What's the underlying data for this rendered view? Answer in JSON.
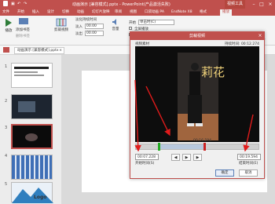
{
  "window": {
    "title": "动画演示 [兼容模式].pptx - PowerPoint(产品激活失败)",
    "tools_tab": "视频工具"
  },
  "tabs": [
    "文件",
    "开始",
    "插入",
    "设计",
    "切换",
    "动画",
    "幻灯片放映",
    "审阅",
    "视图",
    "口袋动画 PA",
    "EndNote X8",
    "格式",
    "播放"
  ],
  "ribbon": {
    "preview_label": "播放",
    "add_bookmark_label": "添加书签",
    "remove_bookmark_label": "删除书签",
    "trim_label": "剪裁视频",
    "fade_label": "淡化持续时间",
    "fade_in_label": "淡入",
    "fade_in_value": "00.00",
    "fade_out_label": "淡出",
    "fade_out_value": "00.00",
    "volume_label": "音量",
    "start_label": "开始",
    "start_value": "单击时(C)",
    "fullscreen_label": "全屏播放",
    "loop_label": "循环播放，直到停止"
  },
  "doc_tab": "动画演示 [兼容模式].pptx",
  "thumbnails": [
    {
      "number": "1"
    },
    {
      "number": "2"
    },
    {
      "number": "3"
    },
    {
      "number": "4"
    },
    {
      "number": "5",
      "logo_text": "Logo"
    }
  ],
  "dialog": {
    "title": "剪裁视频",
    "file_name": "视频素材",
    "duration": "持续时间: 00:12.274",
    "overlay_text": "莉花",
    "current_time": "00:16.594",
    "start_time": "00:07.228",
    "start_label": "开始时间(S)",
    "end_time": "00:19.594",
    "end_label": "结束时间(E)",
    "ok_label": "确定",
    "cancel_label": "取消"
  },
  "trim": {
    "start_fraction": 0.19,
    "end_fraction": 0.56
  },
  "colors": {
    "accent": "#c0504d",
    "marker_start": "#22aa22",
    "marker_end": "#cc2222",
    "annotation_arrow": "#e11b1b"
  }
}
